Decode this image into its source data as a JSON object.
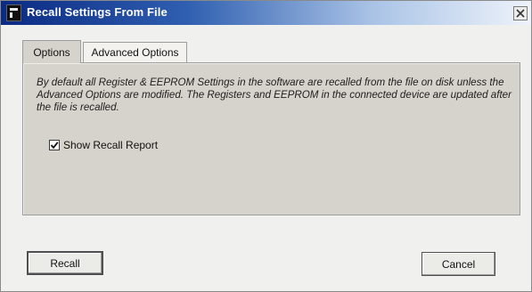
{
  "window": {
    "title": "Recall Settings From File",
    "app_icon": "app-window-icon",
    "close_icon": "close-icon"
  },
  "tabs": [
    {
      "label": "Options",
      "selected": true
    },
    {
      "label": "Advanced Options",
      "selected": false
    }
  ],
  "options_panel": {
    "description": "By default all Register & EEPROM Settings in the software are recalled from the file on disk unless the Advanced Options are modified. The Registers and EEPROM in the connected device are updated after the file is recalled.",
    "show_recall_report": {
      "label": "Show Recall Report",
      "checked": true
    }
  },
  "buttons": {
    "recall": "Recall",
    "cancel": "Cancel"
  }
}
